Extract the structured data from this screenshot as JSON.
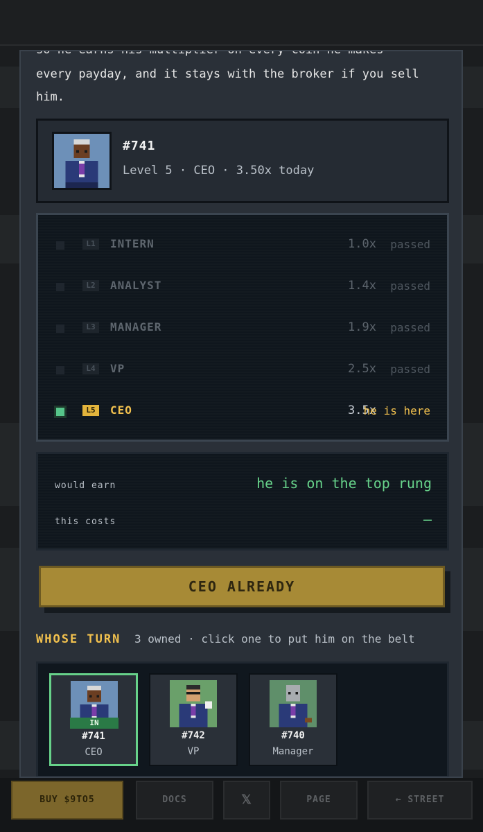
{
  "modal": {
    "intro_cut": "so he earns his multiplier on every coin he makes",
    "intro_line1": "every payday, and it stays with the broker if you sell",
    "intro_line2": "him."
  },
  "card": {
    "id": "#741",
    "subtitle": "Level 5 · CEO · 3.50x today"
  },
  "ladder": [
    {
      "level": "L1",
      "name": "INTERN",
      "mult": "1.0x",
      "state": "passed"
    },
    {
      "level": "L2",
      "name": "ANALYST",
      "mult": "1.4x",
      "state": "passed"
    },
    {
      "level": "L3",
      "name": "MANAGER",
      "mult": "1.9x",
      "state": "passed"
    },
    {
      "level": "L4",
      "name": "VP",
      "mult": "2.5x",
      "state": "passed"
    },
    {
      "level": "L5",
      "name": "CEO",
      "mult": "3.5x",
      "state": "he is here"
    }
  ],
  "earn": {
    "would_earn_label": "would earn",
    "would_earn_value": "he is on the top rung",
    "costs_label": "this costs",
    "costs_value": "–"
  },
  "action_button": "CEO ALREADY",
  "turn": {
    "title": "WHOSE TURN",
    "subtitle": "3 owned · click one to put him on the belt"
  },
  "owned": [
    {
      "id": "#741",
      "role": "CEO",
      "tag": "IN",
      "active": true
    },
    {
      "id": "#742",
      "role": "VP",
      "tag": "",
      "active": false
    },
    {
      "id": "#740",
      "role": "Manager",
      "tag": "",
      "active": false
    }
  ],
  "bottom_bar": {
    "buy": "BUY $9TO5",
    "docs": "DOCS",
    "x": "𝕏",
    "page": "PAGE",
    "street": "← STREET"
  },
  "colors": {
    "accent_gold": "#f2c14e",
    "accent_green": "#67d28a",
    "panel": "#2a3038"
  }
}
